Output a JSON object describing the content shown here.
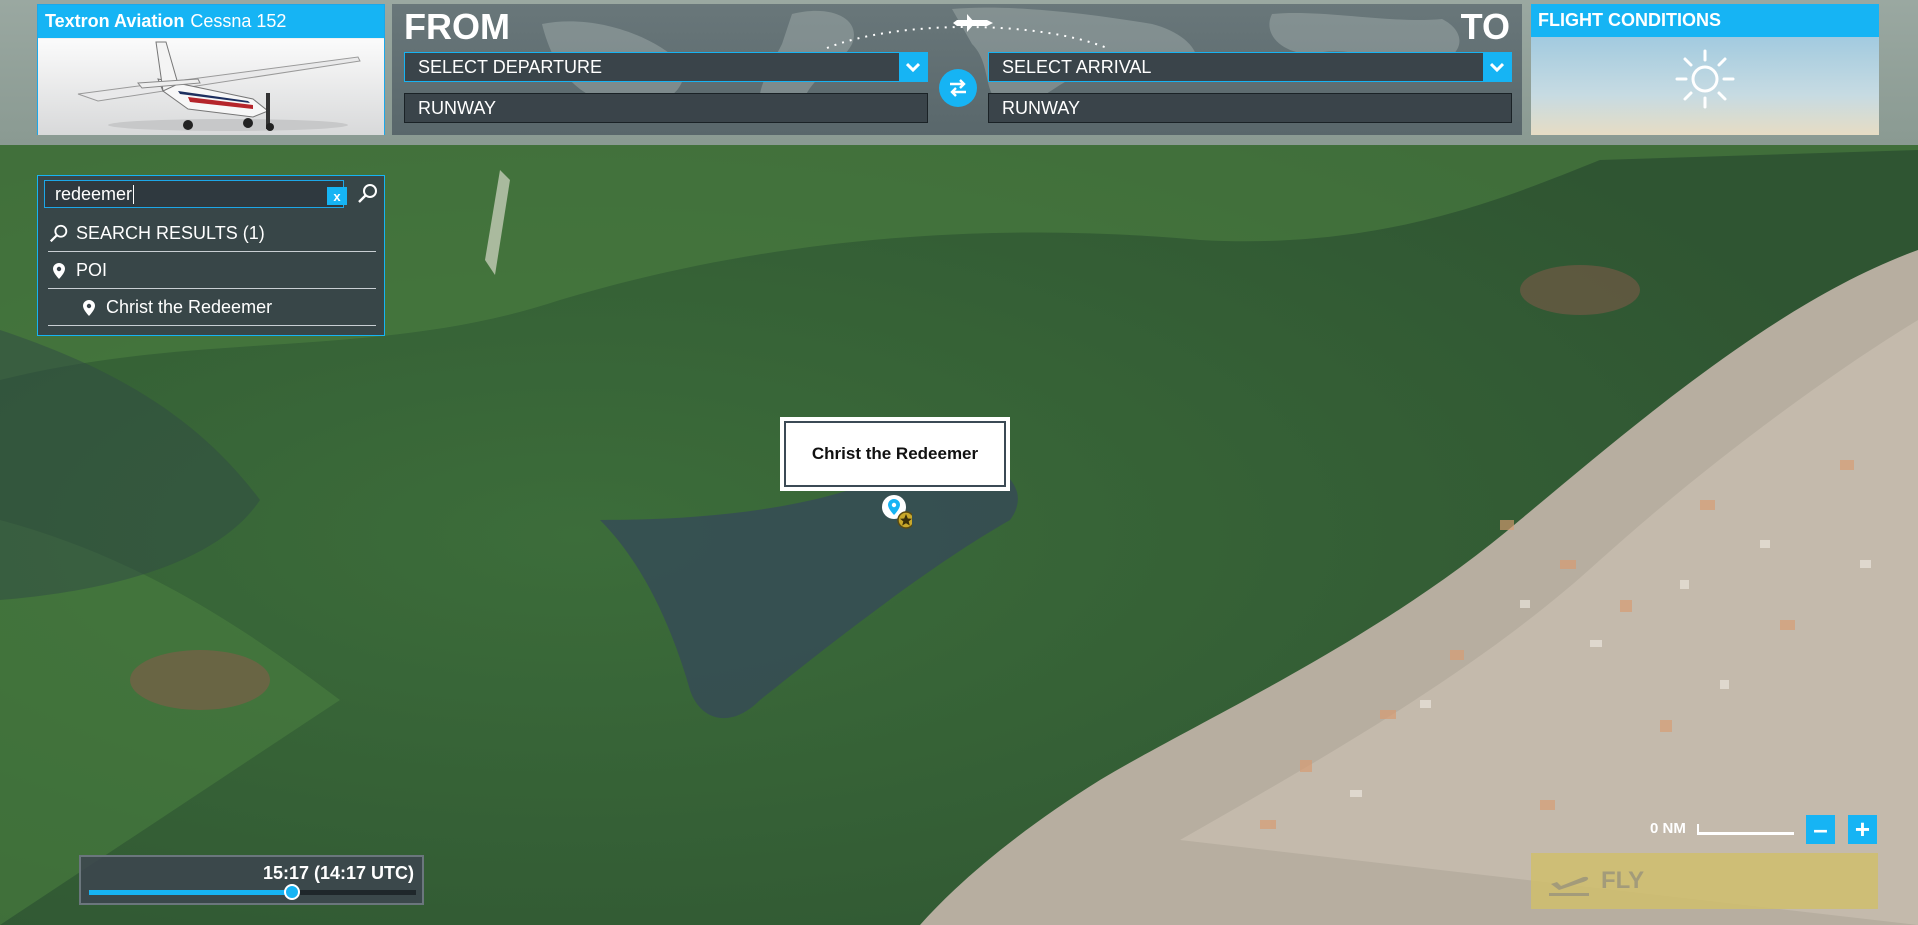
{
  "aircraft": {
    "manufacturer": "Textron Aviation",
    "model": "Cessna 152"
  },
  "route": {
    "from_label": "FROM",
    "to_label": "TO",
    "departure_placeholder": "SELECT DEPARTURE",
    "arrival_placeholder": "SELECT ARRIVAL",
    "departure_runway": "RUNWAY",
    "arrival_runway": "RUNWAY"
  },
  "conditions": {
    "title": "FLIGHT CONDITIONS",
    "weather_icon": "sun-icon"
  },
  "search": {
    "query": "redeemer",
    "clear_label": "x",
    "results_header": "SEARCH RESULTS (1)",
    "category": "POI",
    "results": [
      {
        "label": "Christ the Redeemer"
      }
    ]
  },
  "map": {
    "poi_label": "Christ the Redeemer"
  },
  "time": {
    "display": "15:17 (14:17 UTC)",
    "slider_fraction": 0.62
  },
  "scale": {
    "text": "0 NM"
  },
  "zoom": {
    "minus": "–",
    "plus": "+"
  },
  "fly": {
    "label": "FLY"
  },
  "colors": {
    "accent": "#16b4f4",
    "fly_disabled": "#d0be6c"
  }
}
